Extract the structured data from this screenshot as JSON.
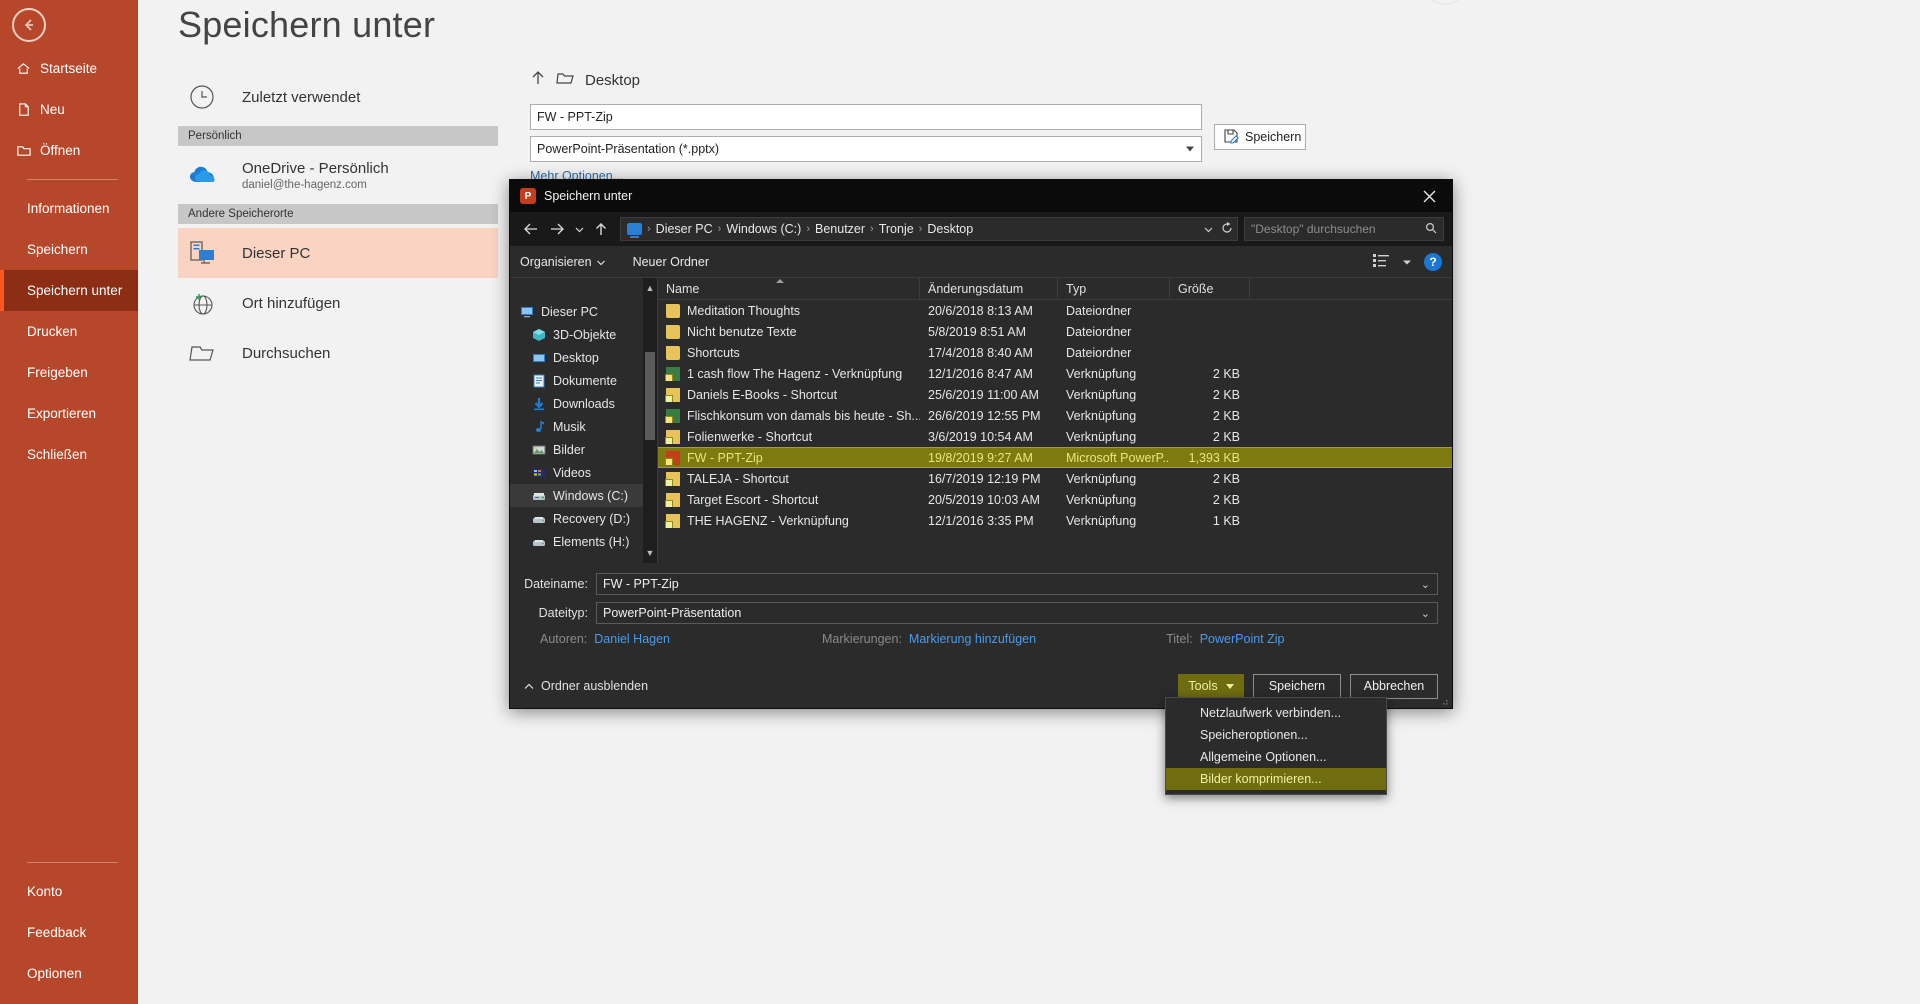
{
  "backstage": {
    "title": "Speichern unter",
    "back_icon": "back-arrow-icon",
    "rail": {
      "top_items": [
        {
          "label": "Startseite",
          "icon": "home-icon"
        },
        {
          "label": "Neu",
          "icon": "new-document-icon"
        },
        {
          "label": "Öffnen",
          "icon": "open-folder-icon"
        }
      ],
      "mid_items": [
        {
          "label": "Informationen"
        },
        {
          "label": "Speichern"
        },
        {
          "label": "Speichern unter",
          "active": true
        },
        {
          "label": "Drucken"
        },
        {
          "label": "Freigeben"
        },
        {
          "label": "Exportieren"
        },
        {
          "label": "Schließen"
        }
      ],
      "bottom_items": [
        {
          "label": "Konto"
        },
        {
          "label": "Feedback"
        },
        {
          "label": "Optionen"
        }
      ]
    },
    "places": {
      "recent": {
        "label": "Zuletzt verwendet",
        "icon": "clock-icon"
      },
      "personal_header": "Persönlich",
      "onedrive": {
        "label": "OneDrive - Persönlich",
        "sub": "daniel@the-hagenz.com",
        "icon": "onedrive-cloud-icon"
      },
      "other_header": "Andere Speicherorte",
      "this_pc": {
        "label": "Dieser PC",
        "icon": "this-pc-icon",
        "selected": true
      },
      "add_place": {
        "label": "Ort hinzufügen",
        "icon": "add-place-globe-icon"
      },
      "browse": {
        "label": "Durchsuchen",
        "icon": "folder-icon"
      }
    },
    "right": {
      "up_icon": "up-arrow-icon",
      "folder_icon": "folder-icon",
      "current_folder": "Desktop",
      "filename_value": "FW - PPT-Zip",
      "filetype_value": "PowerPoint-Präsentation (*.pptx)",
      "more_options_link": "Mehr Optionen...",
      "save_button": "Speichern",
      "save_icon": "save-disk-icon"
    }
  },
  "dialog": {
    "title": "Speichern unter",
    "app_icon": "powerpoint-icon",
    "app_icon_letter": "P",
    "close_icon": "close-icon",
    "nav": {
      "back_icon": "back-arrow-icon",
      "forward_icon": "forward-arrow-icon",
      "recent_icon": "chevron-down-icon",
      "up_icon": "up-arrow-icon",
      "breadcrumbs": [
        "Dieser PC",
        "Windows (C:)",
        "Benutzer",
        "Tronje",
        "Desktop"
      ],
      "dropdown_icon": "chevron-down-icon",
      "refresh_icon": "refresh-icon",
      "search_placeholder": "\"Desktop\" durchsuchen",
      "search_icon": "search-icon"
    },
    "toolbar": {
      "organize": "Organisieren",
      "new_folder": "Neuer Ordner",
      "view_icon": "view-list-icon",
      "view_caret_icon": "chevron-down-icon",
      "help_icon": "help-icon",
      "help_label": "?"
    },
    "tree": {
      "items": [
        {
          "label": "Dieser PC",
          "icon": "monitor-icon",
          "level": 0
        },
        {
          "label": "3D-Objekte",
          "icon": "3d-object-icon",
          "level": 1
        },
        {
          "label": "Desktop",
          "icon": "desktop-icon",
          "level": 1
        },
        {
          "label": "Dokumente",
          "icon": "documents-icon",
          "level": 1
        },
        {
          "label": "Downloads",
          "icon": "download-arrow-icon",
          "level": 1
        },
        {
          "label": "Musik",
          "icon": "music-note-icon",
          "level": 1
        },
        {
          "label": "Bilder",
          "icon": "picture-icon",
          "level": 1
        },
        {
          "label": "Videos",
          "icon": "video-icon",
          "level": 1
        },
        {
          "label": "Windows (C:)",
          "icon": "hard-drive-icon",
          "level": 1,
          "selected": true
        },
        {
          "label": "Recovery (D:)",
          "icon": "drive-icon",
          "level": 1
        },
        {
          "label": "Elements (H:)",
          "icon": "drive-icon",
          "level": 1
        }
      ],
      "scroll_up_icon": "chevron-up-icon",
      "scroll_down_icon": "chevron-down-icon"
    },
    "filelist": {
      "columns": [
        "Name",
        "Änderungsdatum",
        "Typ",
        "Größe"
      ],
      "sort_indicator_icon": "sort-ascending-icon",
      "rows": [
        {
          "name": "Meditation Thoughts",
          "date": "20/6/2018 8:13 AM",
          "type": "Dateiordner",
          "size": "",
          "icon": "folder-icon"
        },
        {
          "name": "Nicht benutze Texte",
          "date": "5/8/2019 8:51 AM",
          "type": "Dateiordner",
          "size": "",
          "icon": "folder-icon"
        },
        {
          "name": "Shortcuts",
          "date": "17/4/2018 8:40 AM",
          "type": "Dateiordner",
          "size": "",
          "icon": "folder-icon"
        },
        {
          "name": "1 cash flow The Hagenz - Verknüpfung",
          "date": "12/1/2016 8:47 AM",
          "type": "Verknüpfung",
          "size": "2 KB",
          "icon": "excel-shortcut-icon"
        },
        {
          "name": "Daniels E-Books - Shortcut",
          "date": "25/6/2019 11:00 AM",
          "type": "Verknüpfung",
          "size": "2 KB",
          "icon": "folder-shortcut-icon"
        },
        {
          "name": "Flischkonsum von damals bis heute - Sh...",
          "date": "26/6/2019 12:55 PM",
          "type": "Verknüpfung",
          "size": "2 KB",
          "icon": "excel-shortcut-icon"
        },
        {
          "name": "Folienwerke - Shortcut",
          "date": "3/6/2019 10:54 AM",
          "type": "Verknüpfung",
          "size": "2 KB",
          "icon": "folder-shortcut-icon"
        },
        {
          "name": "FW - PPT-Zip",
          "date": "19/8/2019 9:27 AM",
          "type": "Microsoft PowerP...",
          "size": "1,393 KB",
          "icon": "powerpoint-icon",
          "selected": true
        },
        {
          "name": "TALEJA - Shortcut",
          "date": "16/7/2019 12:19 PM",
          "type": "Verknüpfung",
          "size": "2 KB",
          "icon": "folder-shortcut-icon"
        },
        {
          "name": "Target Escort - Shortcut",
          "date": "20/5/2019 10:03 AM",
          "type": "Verknüpfung",
          "size": "2 KB",
          "icon": "folder-shortcut-icon"
        },
        {
          "name": "THE HAGENZ - Verknüpfung",
          "date": "12/1/2016 3:35 PM",
          "type": "Verknüpfung",
          "size": "1 KB",
          "icon": "folder-shortcut-icon"
        }
      ]
    },
    "fields": {
      "filename_label": "Dateiname:",
      "filename_value": "FW - PPT-Zip",
      "filetype_label": "Dateityp:",
      "filetype_value": "PowerPoint-Präsentation",
      "caret_icon": "chevron-down-icon",
      "authors_label": "Autoren:",
      "authors_value": "Daniel Hagen",
      "tags_label": "Markierungen:",
      "tags_value": "Markierung hinzufügen",
      "title_label": "Titel:",
      "title_value": "PowerPoint Zip"
    },
    "footer": {
      "hide_folders": "Ordner ausblenden",
      "hide_folders_icon": "chevron-up-icon",
      "tools_button": "Tools",
      "tools_caret_icon": "chevron-down-icon",
      "save_button": "Speichern",
      "cancel_button": "Abbrechen",
      "resize_grip_icon": "resize-grip-icon"
    },
    "tools_menu": {
      "items": [
        {
          "label": "Netzlaufwerk verbinden..."
        },
        {
          "label": "Speicheroptionen..."
        },
        {
          "label": "Allgemeine Optionen..."
        },
        {
          "label": "Bilder komprimieren...",
          "highlighted": true
        }
      ]
    }
  },
  "colors": {
    "brand": "#b7472a",
    "brand_active": "#8c2d15",
    "selection_highlight": "#7d7a10",
    "menu_highlight": "#6f6d10",
    "link": "#4a9bea",
    "backstage_link": "#2e6da4"
  }
}
